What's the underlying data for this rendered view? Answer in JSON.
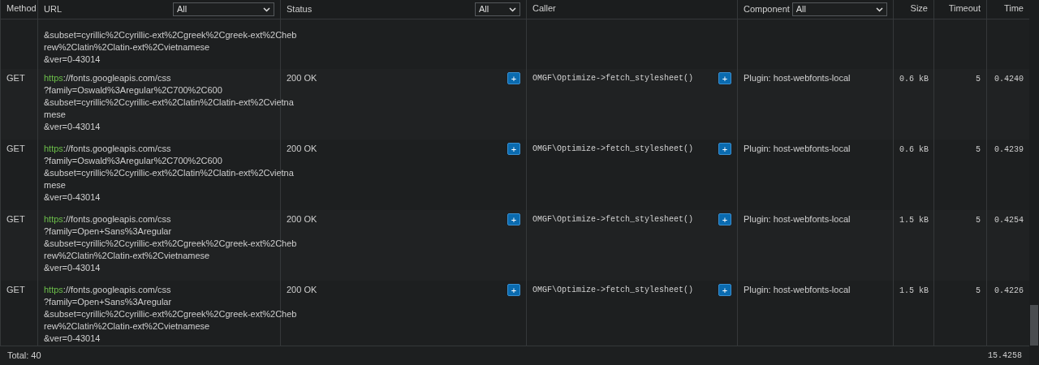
{
  "columns": [
    {
      "label": "Method"
    },
    {
      "label": "URL",
      "filter": "All"
    },
    {
      "label": "Status",
      "filter": "All"
    },
    {
      "label": "Caller"
    },
    {
      "label": "Component",
      "filter": "All"
    },
    {
      "label": "Size"
    },
    {
      "label": "Timeout"
    },
    {
      "label": "Time"
    }
  ],
  "rows": [
    {
      "url": {
        "lines": [
          "&subset=cyrillic%2Ccyrillic-ext%2Cgreek%2Cgreek-ext%2Cheb",
          "rew%2Clatin%2Clatin-ext%2Cvietnamese",
          "&ver=0-43014"
        ]
      }
    },
    {
      "method": "GET",
      "url": {
        "scheme": "https",
        "rest": "://fonts.googleapis.com/css",
        "lines": [
          "?family=Oswald%3Aregular%2C700%2C600",
          "&subset=cyrillic%2Ccyrillic-ext%2Clatin%2Clatin-ext%2Cvietna",
          "mese",
          "&ver=0-43014"
        ]
      },
      "status": "200 OK",
      "status_toggle": "+",
      "caller": "OMGF\\Optimize->fetch_stylesheet()",
      "caller_toggle": "+",
      "component": "Plugin: host-webfonts-local",
      "size": "0.6 kB",
      "timeout": "5",
      "time": "0.4240"
    },
    {
      "method": "GET",
      "url": {
        "scheme": "https",
        "rest": "://fonts.googleapis.com/css",
        "lines": [
          "?family=Oswald%3Aregular%2C700%2C600",
          "&subset=cyrillic%2Ccyrillic-ext%2Clatin%2Clatin-ext%2Cvietna",
          "mese",
          "&ver=0-43014"
        ]
      },
      "status": "200 OK",
      "status_toggle": "+",
      "caller": "OMGF\\Optimize->fetch_stylesheet()",
      "caller_toggle": "+",
      "component": "Plugin: host-webfonts-local",
      "size": "0.6 kB",
      "timeout": "5",
      "time": "0.4239"
    },
    {
      "method": "GET",
      "url": {
        "scheme": "https",
        "rest": "://fonts.googleapis.com/css",
        "lines": [
          "?family=Open+Sans%3Aregular",
          "&subset=cyrillic%2Ccyrillic-ext%2Cgreek%2Cgreek-ext%2Cheb",
          "rew%2Clatin%2Clatin-ext%2Cvietnamese",
          "&ver=0-43014"
        ]
      },
      "status": "200 OK",
      "status_toggle": "+",
      "caller": "OMGF\\Optimize->fetch_stylesheet()",
      "caller_toggle": "+",
      "component": "Plugin: host-webfonts-local",
      "size": "1.5 kB",
      "timeout": "5",
      "time": "0.4254"
    },
    {
      "method": "GET",
      "url": {
        "scheme": "https",
        "rest": "://fonts.googleapis.com/css",
        "lines": [
          "?family=Open+Sans%3Aregular",
          "&subset=cyrillic%2Ccyrillic-ext%2Cgreek%2Cgreek-ext%2Cheb",
          "rew%2Clatin%2Clatin-ext%2Cvietnamese",
          "&ver=0-43014"
        ]
      },
      "status": "200 OK",
      "status_toggle": "+",
      "caller": "OMGF\\Optimize->fetch_stylesheet()",
      "caller_toggle": "+",
      "component": "Plugin: host-webfonts-local",
      "size": "1.5 kB",
      "timeout": "5",
      "time": "0.4226"
    }
  ],
  "footer": {
    "total": "Total: 40",
    "time_total": "15.4258"
  }
}
